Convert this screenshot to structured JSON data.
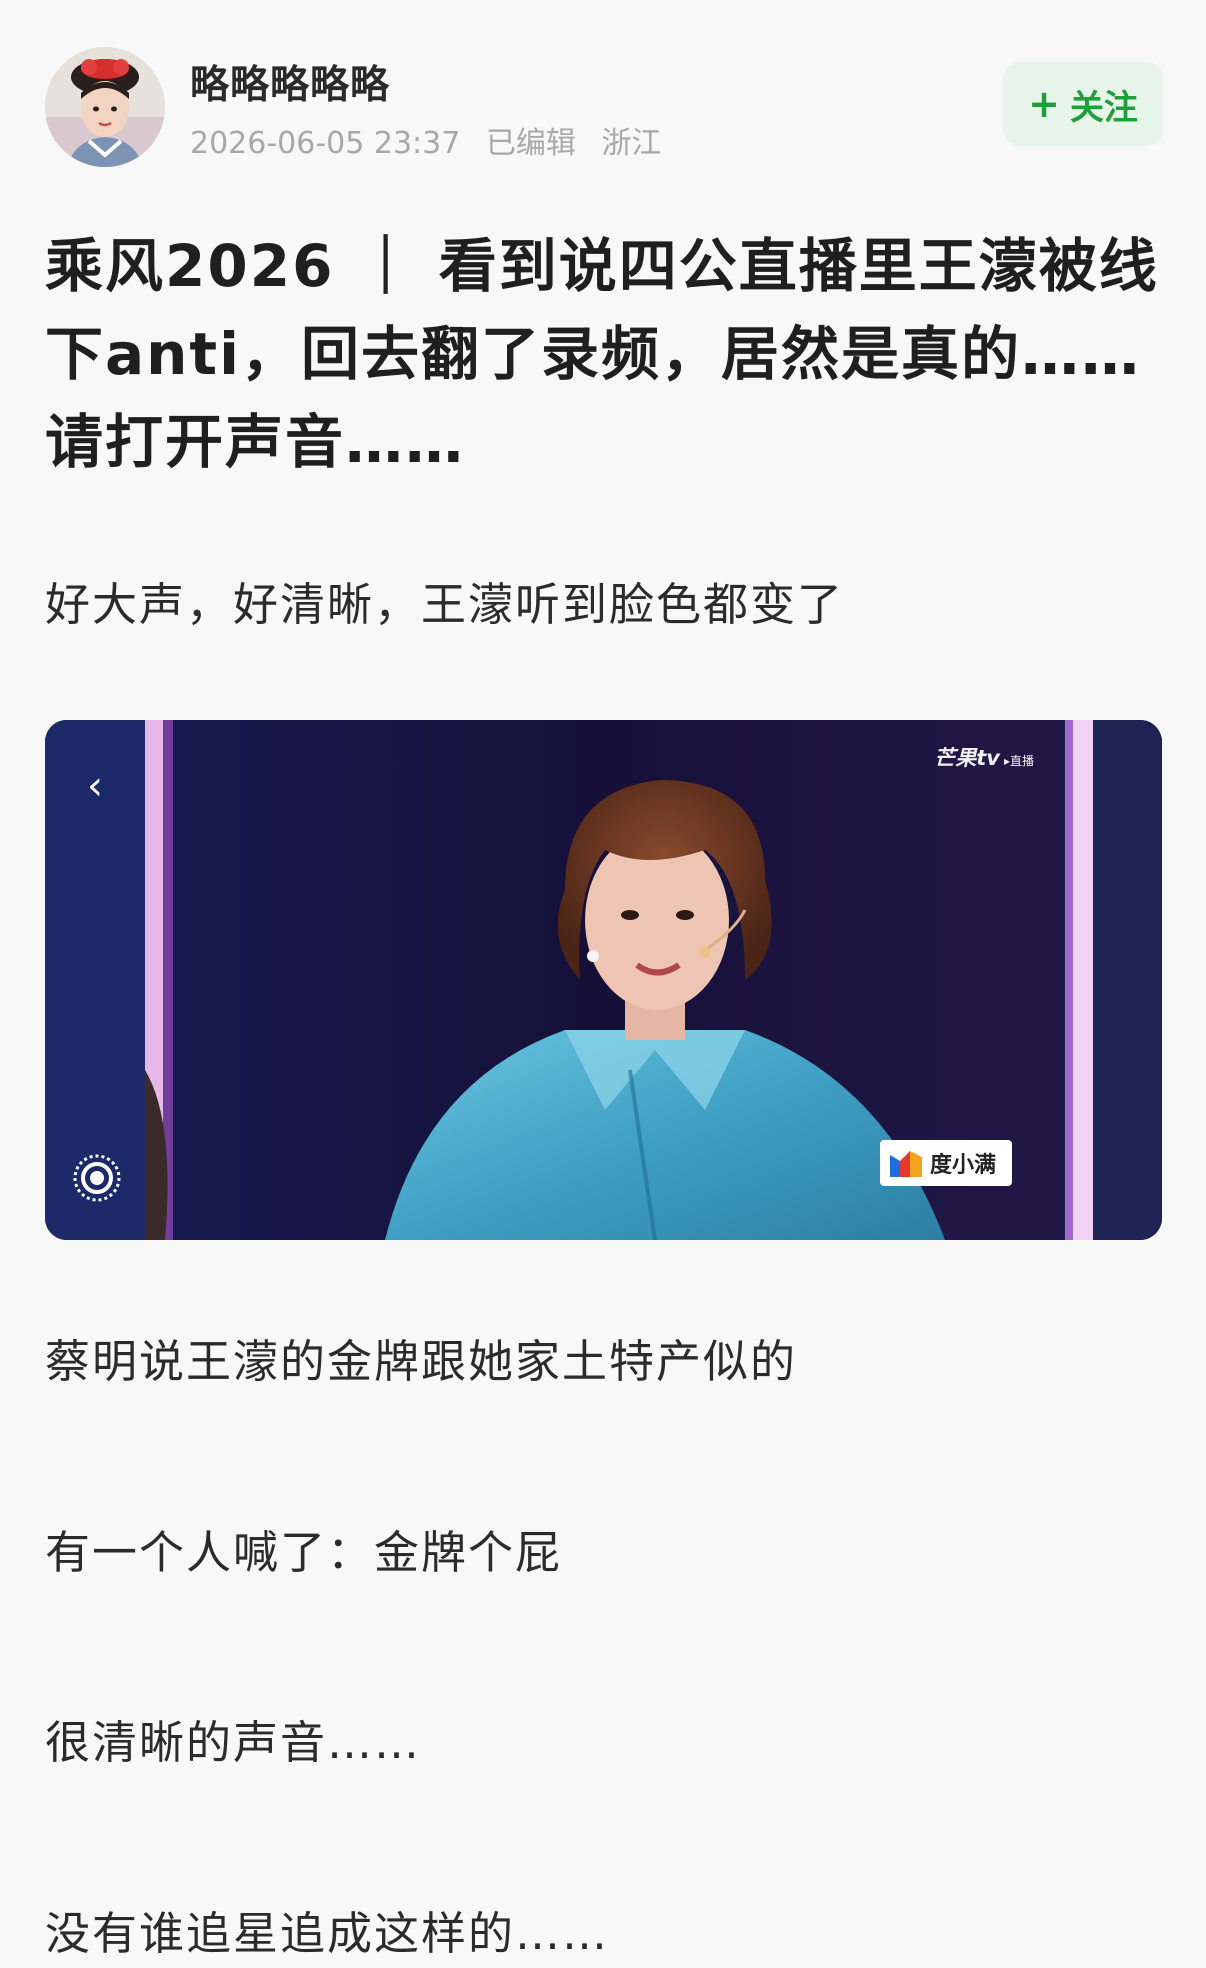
{
  "author": {
    "name": "略略略略略",
    "timestamp": "2026-06-05 23:37",
    "edited": "已编辑",
    "location": "浙江",
    "avatar_icon": "avatar-icon"
  },
  "follow": {
    "plus": "+",
    "label": "关注",
    "color": "#1f9f3a",
    "background": "#e7f4e9"
  },
  "post": {
    "title": "乘风2026 ｜ 看到说四公直播里王濛被线下anti，回去翻了录频，居然是真的……请打开声音……",
    "paragraphs": [
      "好大声，好清晰，王濛听到脸色都变了",
      "蔡明说王濛的金牌跟她家土特产似的",
      "有一个人喊了：金牌个屁",
      "很清晰的声音……",
      "没有谁追星追成这样的……"
    ]
  },
  "video": {
    "back_icon": "chevron-left-icon",
    "back_glyph": "‹",
    "live_icon": "live-target-icon",
    "watermark_main": "芒果tv",
    "watermark_live": "▸直播",
    "sponsor_label": "度小满",
    "sponsor_icon": "duxiaoman-logo-icon"
  }
}
